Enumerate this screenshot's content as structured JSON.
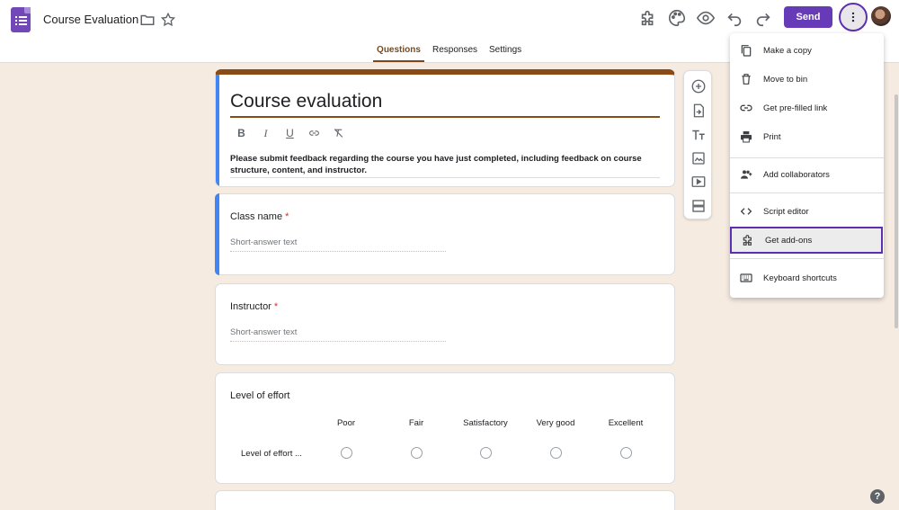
{
  "header": {
    "doc_title": "Course Evaluation",
    "send_label": "Send",
    "help_label": "?"
  },
  "tabs": [
    {
      "label": "Questions",
      "active": true
    },
    {
      "label": "Responses",
      "active": false
    },
    {
      "label": "Settings",
      "active": false
    }
  ],
  "form": {
    "title": "Course evaluation",
    "format_buttons": [
      "B",
      "I",
      "U"
    ],
    "description": "Please submit feedback regarding the course you have just completed, including feedback on course structure, content, and instructor.",
    "questions": [
      {
        "title": "Class name",
        "required_mark": "*",
        "placeholder": "Short-answer text"
      },
      {
        "title": "Instructor",
        "required_mark": "*",
        "placeholder": "Short-answer text"
      }
    ],
    "grid": {
      "title": "Level of effort",
      "columns": [
        "Poor",
        "Fair",
        "Satisfactory",
        "Very good",
        "Excellent"
      ],
      "row_label": "Level of effort ..."
    }
  },
  "menu": {
    "items": [
      {
        "label": "Make a copy",
        "icon": "copy-icon"
      },
      {
        "label": "Move to bin",
        "icon": "trash-icon"
      },
      {
        "label": "Get pre-filled link",
        "icon": "link-icon"
      },
      {
        "label": "Print",
        "icon": "printer-icon"
      },
      {
        "label": "Add collaborators",
        "icon": "add-people-icon"
      },
      {
        "label": "Script editor",
        "icon": "code-icon"
      },
      {
        "label": "Get add-ons",
        "icon": "puzzle-icon",
        "highlighted": true
      },
      {
        "label": "Keyboard shortcuts",
        "icon": "keyboard-icon"
      }
    ]
  },
  "colors": {
    "accent": "#673ab7",
    "highlight_border": "#5b2fb0",
    "theme": "#8a4b16",
    "background": "#f5ebe1",
    "active_question": "#4285f4",
    "required": "#d93025"
  }
}
